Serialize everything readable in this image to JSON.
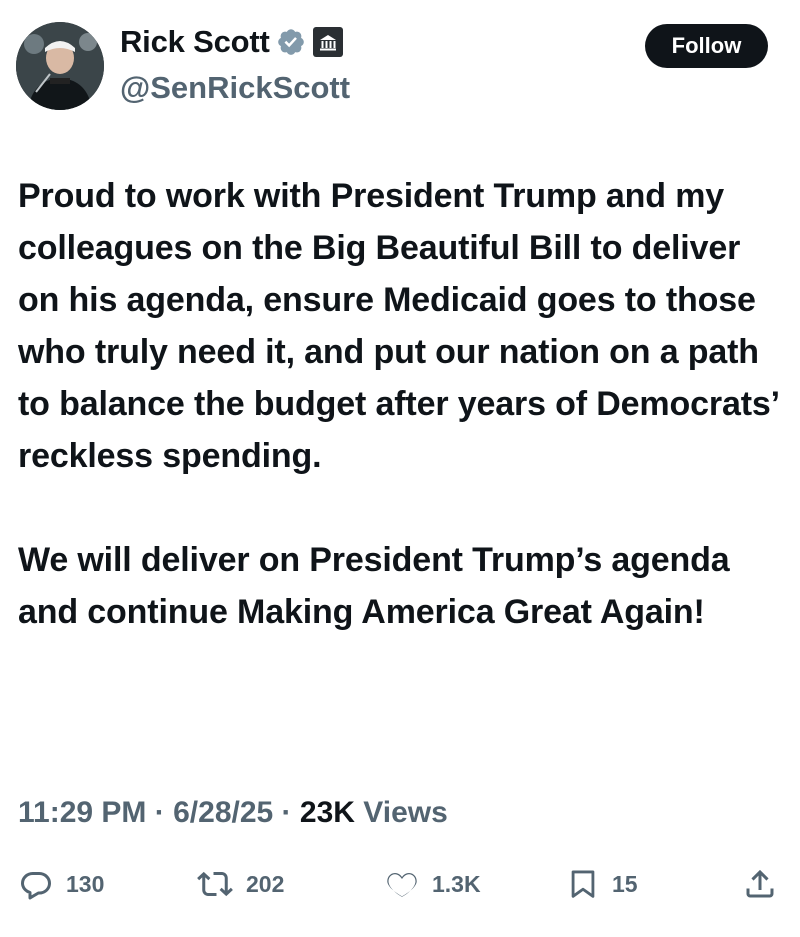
{
  "author": {
    "name": "Rick Scott",
    "handle": "@SenRickScott",
    "avatar_icon": "profile-photo",
    "badges": [
      "verified-badge-icon",
      "government-affiliation-icon"
    ]
  },
  "follow_button": {
    "label": "Follow"
  },
  "tweet": {
    "paragraphs": [
      "Proud to work with President Trump and my colleagues on the Big Beautiful Bill to deliver on his agenda, ensure Medicaid goes to those who truly need it, and put our nation on a path to balance the budget after years of Democrats’ reckless spending.",
      "We will deliver on President Trump’s agenda and continue Making America Great Again!"
    ]
  },
  "meta": {
    "time": "11:29 PM",
    "separator": "·",
    "date": "6/28/25",
    "views_count": "23K",
    "views_label": "Views"
  },
  "actions": {
    "replies": {
      "icon": "reply-icon",
      "count": "130"
    },
    "reposts": {
      "icon": "repost-icon",
      "count": "202"
    },
    "likes": {
      "icon": "heart-icon",
      "count": "1.3K"
    },
    "bookmarks": {
      "icon": "bookmark-icon",
      "count": "15"
    },
    "share": {
      "icon": "share-icon"
    }
  },
  "colors": {
    "text": "#0f1419",
    "secondary": "#536471",
    "verified_badge": "#829aab",
    "follow_bg": "#0f1419",
    "follow_text": "#ffffff"
  }
}
